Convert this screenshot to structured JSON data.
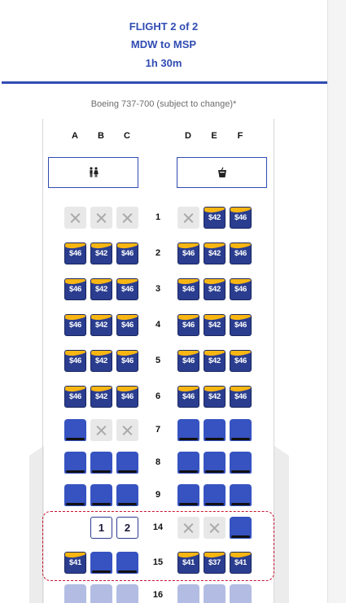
{
  "header": {
    "flight": "FLIGHT 2 of 2",
    "route": "MDW to MSP",
    "duration": "1h 30m"
  },
  "aircraft": "Boeing 737-700 (subject to change)*",
  "columns": [
    "A",
    "B",
    "C",
    "D",
    "E",
    "F"
  ],
  "facilities": {
    "left": "restroom-icon",
    "right": "drink-icon"
  },
  "rows": [
    {
      "number": "1",
      "seats": [
        {
          "t": "taken"
        },
        {
          "t": "taken"
        },
        {
          "t": "taken"
        },
        {
          "t": "taken"
        },
        {
          "t": "price",
          "label": "$42"
        },
        {
          "t": "price",
          "label": "$46"
        }
      ]
    },
    {
      "number": "2",
      "seats": [
        {
          "t": "price",
          "label": "$46"
        },
        {
          "t": "price",
          "label": "$42"
        },
        {
          "t": "price",
          "label": "$46"
        },
        {
          "t": "price",
          "label": "$46"
        },
        {
          "t": "price",
          "label": "$42"
        },
        {
          "t": "price",
          "label": "$46"
        }
      ]
    },
    {
      "number": "3",
      "seats": [
        {
          "t": "price",
          "label": "$46"
        },
        {
          "t": "price",
          "label": "$42"
        },
        {
          "t": "price",
          "label": "$46"
        },
        {
          "t": "price",
          "label": "$46"
        },
        {
          "t": "price",
          "label": "$42"
        },
        {
          "t": "price",
          "label": "$46"
        }
      ]
    },
    {
      "number": "4",
      "seats": [
        {
          "t": "price",
          "label": "$46"
        },
        {
          "t": "price",
          "label": "$42"
        },
        {
          "t": "price",
          "label": "$46"
        },
        {
          "t": "price",
          "label": "$46"
        },
        {
          "t": "price",
          "label": "$42"
        },
        {
          "t": "price",
          "label": "$46"
        }
      ]
    },
    {
      "number": "5",
      "seats": [
        {
          "t": "price",
          "label": "$46"
        },
        {
          "t": "price",
          "label": "$42"
        },
        {
          "t": "price",
          "label": "$46"
        },
        {
          "t": "price",
          "label": "$46"
        },
        {
          "t": "price",
          "label": "$42"
        },
        {
          "t": "price",
          "label": "$46"
        }
      ]
    },
    {
      "number": "6",
      "seats": [
        {
          "t": "price",
          "label": "$46"
        },
        {
          "t": "price",
          "label": "$42"
        },
        {
          "t": "price",
          "label": "$46"
        },
        {
          "t": "price",
          "label": "$46"
        },
        {
          "t": "price",
          "label": "$42"
        },
        {
          "t": "price",
          "label": "$46"
        }
      ]
    },
    {
      "number": "7",
      "seats": [
        {
          "t": "open"
        },
        {
          "t": "taken"
        },
        {
          "t": "taken"
        },
        {
          "t": "open"
        },
        {
          "t": "open"
        },
        {
          "t": "open"
        }
      ]
    },
    {
      "number": "8",
      "seats": [
        {
          "t": "open"
        },
        {
          "t": "open"
        },
        {
          "t": "open"
        },
        {
          "t": "open"
        },
        {
          "t": "open"
        },
        {
          "t": "open"
        }
      ]
    },
    {
      "number": "9",
      "seats": [
        {
          "t": "open"
        },
        {
          "t": "open"
        },
        {
          "t": "open"
        },
        {
          "t": "open"
        },
        {
          "t": "open"
        },
        {
          "t": "open"
        }
      ]
    },
    {
      "number": "14",
      "seats": [
        {
          "t": "none"
        },
        {
          "t": "num",
          "label": "1"
        },
        {
          "t": "num",
          "label": "2"
        },
        {
          "t": "taken"
        },
        {
          "t": "taken"
        },
        {
          "t": "open"
        }
      ]
    },
    {
      "number": "15",
      "seats": [
        {
          "t": "price",
          "label": "$41"
        },
        {
          "t": "open"
        },
        {
          "t": "open"
        },
        {
          "t": "price",
          "label": "$41"
        },
        {
          "t": "price",
          "label": "$37"
        },
        {
          "t": "price",
          "label": "$41"
        }
      ]
    },
    {
      "number": "16",
      "seats": [
        {
          "t": "light"
        },
        {
          "t": "light"
        },
        {
          "t": "light"
        },
        {
          "t": "light"
        },
        {
          "t": "light"
        },
        {
          "t": "light"
        }
      ]
    }
  ]
}
